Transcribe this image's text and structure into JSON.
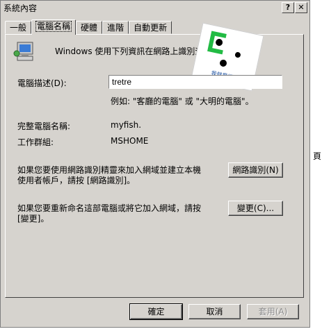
{
  "window": {
    "title": "系統內容",
    "help_label": "?",
    "close_label": "✕"
  },
  "tabs": [
    {
      "label": "一般"
    },
    {
      "label": "電腦名稱"
    },
    {
      "label": "硬體"
    },
    {
      "label": "進階"
    },
    {
      "label": "自動更新"
    }
  ],
  "intro_text": "Windows 使用下列資訊在網路上識別這",
  "sticker_text": "我就是機車",
  "description": {
    "label": "電腦描述(D):",
    "value": "tretre",
    "example": "例如: \"客廳的電腦\" 或 \"大明的電腦\"。"
  },
  "full_name": {
    "label": "完整電腦名稱:",
    "value": "myfish."
  },
  "workgroup": {
    "label": "工作群組:",
    "value": "MSHOME"
  },
  "network_id": {
    "text_line1": "如果您要使用網路識別精靈來加入網域並建立本機",
    "text_line2": "使用者帳戶，請按 [網路識別]。",
    "button": "網路識別(N)"
  },
  "rename": {
    "text_line1": "如果您要重新命名這部電腦或將它加入網域，請按",
    "text_line2": "[變更]。",
    "button": "變更(C)..."
  },
  "footer": {
    "ok": "確定",
    "cancel": "取消",
    "apply": "套用(A)"
  },
  "side_text": "頁"
}
